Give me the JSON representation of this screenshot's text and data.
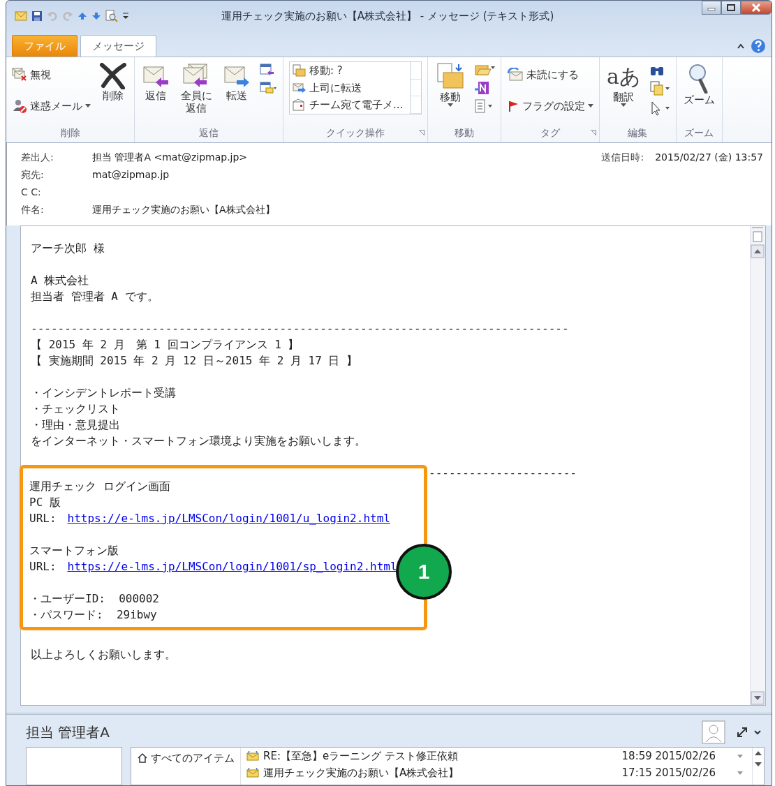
{
  "window": {
    "title": "運用チェック実施のお願い【A株式会社】 - メッセージ (テキスト形式)"
  },
  "tabs": [
    {
      "label": "ファイル",
      "kind": "file",
      "selected": false
    },
    {
      "label": "メッセージ",
      "kind": "tab",
      "selected": true
    }
  ],
  "ribbon": [
    {
      "label": "削除",
      "items": [
        {
          "kind": "stack",
          "items": [
            {
              "label": "無視"
            },
            {
              "label": "迷惑メール",
              "dropdown": true
            }
          ]
        },
        {
          "kind": "large",
          "label": "削除"
        }
      ]
    },
    {
      "label": "返信",
      "items": [
        {
          "kind": "large",
          "label": "返信"
        },
        {
          "kind": "large",
          "label": "全員に返信"
        },
        {
          "kind": "large",
          "label": "転送"
        },
        {
          "kind": "icons"
        }
      ]
    },
    {
      "label": "クイック操作",
      "launcher": true,
      "items": [
        {
          "kind": "quick",
          "items": [
            "移動: ?",
            "上司に転送",
            "チーム宛て電子メ..."
          ]
        }
      ]
    },
    {
      "label": "移動",
      "items": [
        {
          "kind": "large",
          "label": "移動",
          "dropdown": true
        },
        {
          "kind": "icons"
        }
      ]
    },
    {
      "label": "タグ",
      "launcher": true,
      "items": [
        {
          "kind": "stack",
          "items": [
            {
              "label": "未読にする"
            },
            {
              "label": "フラグの設定",
              "dropdown": true
            }
          ]
        }
      ]
    },
    {
      "label": "編集",
      "items": [
        {
          "kind": "large",
          "label": "翻訳",
          "glyph": "aあ",
          "dropdown": true
        },
        {
          "kind": "icons"
        }
      ]
    },
    {
      "label": "ズーム",
      "items": [
        {
          "kind": "large",
          "label": "ズーム"
        }
      ]
    }
  ],
  "header": {
    "fields": [
      {
        "label": "差出人:",
        "value": "担当 管理者A <mat@zipmap.jp>"
      },
      {
        "label": "宛先:",
        "value": "mat@zipmap.jp"
      },
      {
        "label": "C C:"
      },
      {
        "label": "件名:",
        "value": "運用チェック実施のお願い【A株式会社】"
      }
    ],
    "sent": {
      "label": "送信日時:",
      "value": "2015/02/27 (金) 13:57"
    }
  },
  "body": [
    {
      "kind": "line",
      "text": "アーチ次郎 様"
    },
    {
      "kind": "gap"
    },
    {
      "kind": "line",
      "text": "A 株式会社"
    },
    {
      "kind": "line",
      "text": "担当者 管理者 A です。"
    },
    {
      "kind": "gap"
    },
    {
      "kind": "rule",
      "text": "--------------------------------------------------------------------------------"
    },
    {
      "kind": "line",
      "text": "【 2015 年 2 月　第 1 回コンプライアンス 1 】"
    },
    {
      "kind": "line",
      "text": "【 実施期間 2015 年 2 月 12 日～2015 年 2 月 17 日 】"
    },
    {
      "kind": "gap"
    },
    {
      "kind": "line",
      "text": "・インシデントレポート受講"
    },
    {
      "kind": "line",
      "text": "・チェックリスト"
    },
    {
      "kind": "line",
      "text": "・理由・意見提出"
    },
    {
      "kind": "line",
      "text": "をインターネット・スマートフォン環境より実施をお願いします。"
    },
    {
      "kind": "gap"
    },
    {
      "kind": "callout",
      "badge": "1",
      "rule": "----------------------",
      "blocks": [
        {
          "kind": "line",
          "text": "運用チェック ログイン画面"
        },
        {
          "kind": "line",
          "text": "PC 版"
        },
        {
          "kind": "url",
          "label": "URL:",
          "link": "https://e-lms.jp/LMSCon/login/1001/u_login2.html"
        },
        {
          "kind": "gap"
        },
        {
          "kind": "line",
          "text": "スマートフォン版"
        },
        {
          "kind": "url",
          "label": "URL:",
          "link": "https://e-lms.jp/LMSCon/login/1001/sp_login2.html"
        },
        {
          "kind": "gap"
        },
        {
          "kind": "line",
          "text": "・ユーザーID:  000002"
        },
        {
          "kind": "line",
          "text": "・パスワード:  29ibwy"
        }
      ]
    },
    {
      "kind": "gap"
    },
    {
      "kind": "line",
      "text": "以上よろしくお願いします。"
    }
  ],
  "people_pane": {
    "name": "担当 管理者A",
    "filter": "すべてのアイテム",
    "messages": [
      {
        "subject": "RE:【至急】eラーニング テスト修正依頼",
        "time": "18:59 2015/02/26"
      },
      {
        "subject": "運用チェック実施のお願い【A株式会社】",
        "time": "17:15 2015/02/26"
      }
    ]
  }
}
